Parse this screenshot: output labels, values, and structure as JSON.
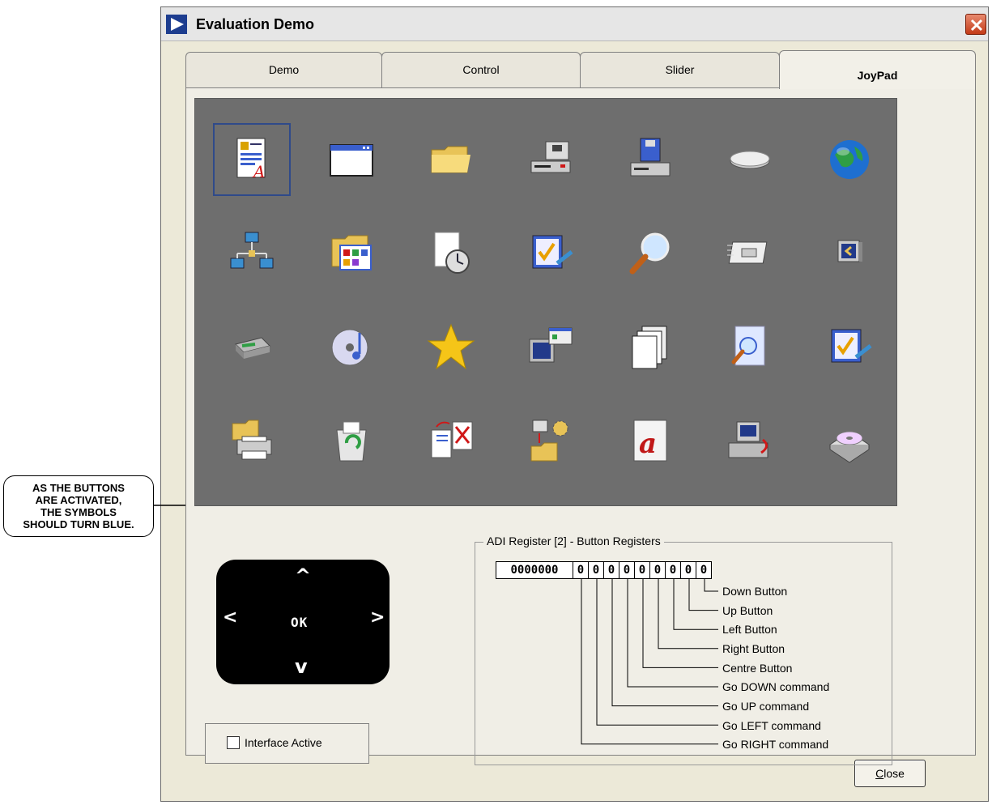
{
  "window": {
    "title": "Evaluation Demo"
  },
  "tabs": [
    {
      "label": "Demo",
      "active": false
    },
    {
      "label": "Control",
      "active": false
    },
    {
      "label": "Slider",
      "active": false
    },
    {
      "label": "JoyPad",
      "active": true
    }
  ],
  "icon_grid": {
    "selected_index": 0,
    "icons": [
      "document-icon",
      "window-icon",
      "folder-icon",
      "drive-icon",
      "computer-icon",
      "disk-icon",
      "globe-icon",
      "network-icon",
      "folder-programs-icon",
      "clock-document-icon",
      "check-edit-icon",
      "magnifier-icon",
      "card-icon",
      "monitor-icon",
      "scanner-icon",
      "cd-music-icon",
      "star-icon",
      "display-properties-icon",
      "pages-icon",
      "search-document-icon",
      "check-edit-icon",
      "printer-icon",
      "recycle-bin-icon",
      "document-copy-icon",
      "network-folder-icon",
      "font-a-icon",
      "computer-restore-icon",
      "cd-drive-icon"
    ]
  },
  "joypad": {
    "up": "^",
    "down": "v",
    "left": "<",
    "right": ">",
    "ok": "OK"
  },
  "interface": {
    "label": "Interface Active",
    "checked": false
  },
  "register": {
    "title": "ADI Register [2] - Button Registers",
    "prefix": "0000000",
    "bits": [
      "0",
      "0",
      "0",
      "0",
      "0",
      "0",
      "0",
      "0",
      "0"
    ],
    "labels": [
      "Down Button",
      "Up Button",
      "Left Button",
      "Right Button",
      "Centre Button",
      "Go DOWN command",
      "Go UP command",
      "Go LEFT command",
      "Go RIGHT command"
    ]
  },
  "close_button": "Close",
  "callout": {
    "lines": [
      "AS THE BUTTONS",
      "ARE ACTIVATED,",
      "THE SYMBOLS",
      "SHOULD TURN BLUE."
    ]
  }
}
